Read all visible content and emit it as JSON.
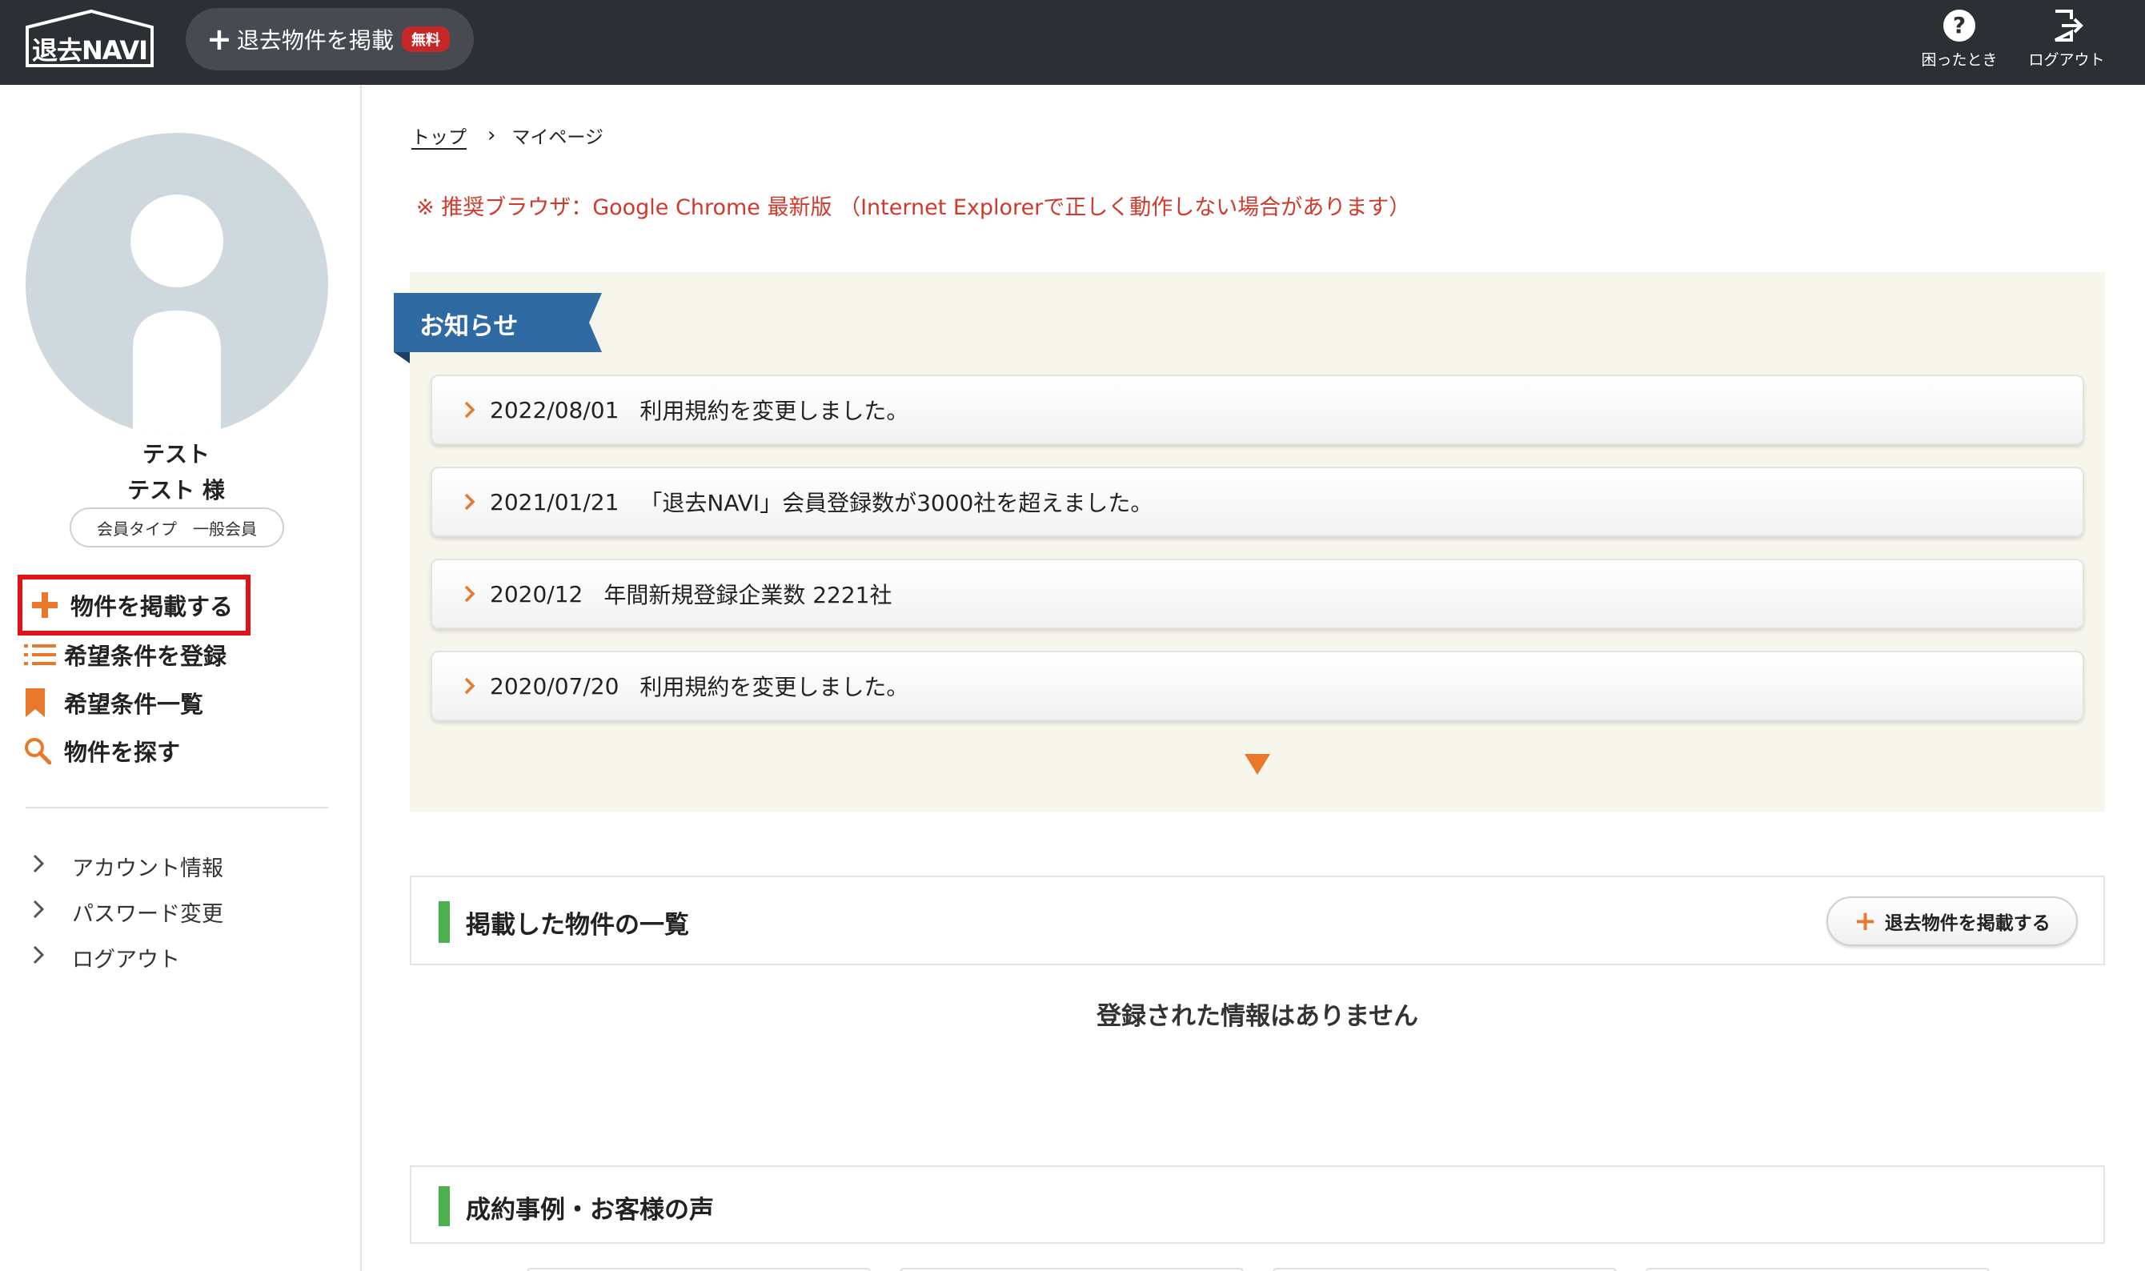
{
  "header": {
    "logo_text": "退去NAVI",
    "post_button_label": "退去物件を掲載",
    "free_badge": "無料",
    "help_label": "困ったとき",
    "logout_label": "ログアウト"
  },
  "user": {
    "company": "テスト",
    "name": "テスト 様",
    "member_type": "会員タイプ　一般会員"
  },
  "sidebar": {
    "menu": [
      {
        "label": "物件を掲載する",
        "icon": "plus-icon"
      },
      {
        "label": "希望条件を登録",
        "icon": "list-icon"
      },
      {
        "label": "希望条件一覧",
        "icon": "bookmark-icon"
      },
      {
        "label": "物件を探す",
        "icon": "search-icon"
      }
    ],
    "links": [
      {
        "label": "アカウント情報"
      },
      {
        "label": "パスワード変更"
      },
      {
        "label": "ログアウト"
      }
    ]
  },
  "breadcrumb": {
    "top": "トップ",
    "current": "マイページ"
  },
  "browser_notice": "※ 推奨ブラウザ：Google Chrome 最新版 （Internet Explorerで正しく動作しない場合があります）",
  "news": {
    "title": "お知らせ",
    "items": [
      {
        "date": "2022/08/01",
        "text": "利用規約を変更しました。"
      },
      {
        "date": "2021/01/21",
        "text": "「退去NAVI」会員登録数が3000社を超えました。"
      },
      {
        "date": "2020/12",
        "text": "年間新規登録企業数 2221社"
      },
      {
        "date": "2020/07/20",
        "text": "利用規約を変更しました。"
      }
    ]
  },
  "listings": {
    "title": "掲載した物件の一覧",
    "post_button": "退去物件を掲載する",
    "empty_message": "登録された情報はありません"
  },
  "testimonials": {
    "title": "成約事例・お客様の声"
  },
  "colors": {
    "header_bg": "#2c2f33",
    "accent_orange": "#e8792b",
    "news_blue": "#2f6aa3",
    "section_green": "#4caf50",
    "highlight_red": "#e0131a",
    "notice_red": "#d0392b"
  }
}
